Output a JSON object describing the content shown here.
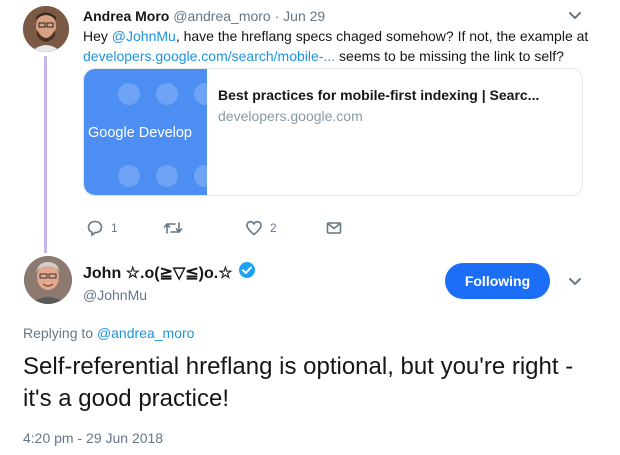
{
  "parent_tweet": {
    "name": "Andrea Moro",
    "handle": "@andrea_moro",
    "date": "· Jun 29",
    "text_prefix": "Hey ",
    "mention": "@JohnMu",
    "text_mid": ", have the hreflang specs chaged somehow? If not, the example at ",
    "link": "developers.google.com/search/mobile-...",
    "text_suffix": " seems to be missing the link to self?",
    "card": {
      "thumb_text": "Google Develop",
      "title": "Best practices for mobile-first indexing  |  Searc...",
      "domain": "developers.google.com"
    },
    "actions": {
      "reply_count": "1",
      "retweet_count": "",
      "like_count": "2"
    }
  },
  "main_tweet": {
    "name": "John ☆.o(≧▽≦)o.☆",
    "handle": "@JohnMu",
    "follow_label": "Following",
    "replying_prefix": "Replying to ",
    "replying_to": "@andrea_moro",
    "text": "Self-referential hreflang is optional, but you're right - it's a good practice!",
    "timestamp": "4:20 pm - 29 Jun 2018"
  },
  "colors": {
    "accent": "#1b95e0",
    "follow_button": "#1d6ef7",
    "thread_line": "#c6b6ef",
    "muted": "#657786"
  }
}
